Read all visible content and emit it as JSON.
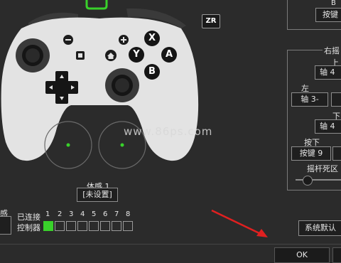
{
  "controller": {
    "zr_label": "ZR",
    "face_buttons": {
      "x": "X",
      "y": "Y",
      "a": "A",
      "b": "B"
    },
    "minus": "−",
    "plus": "+"
  },
  "motion": {
    "title": "体感 1",
    "status": "[未设置]"
  },
  "left_panel": {
    "partial_label": "感"
  },
  "connected": {
    "label_line1": "已连接",
    "label_line2": "控制器",
    "slots": [
      "1",
      "2",
      "3",
      "4",
      "5",
      "6",
      "7",
      "8"
    ],
    "active_slot": 1
  },
  "right_panel": {
    "b_label": "B",
    "b_value": "按键",
    "right_stick_title": "右摇",
    "up_label": "上",
    "up_value": "轴 4",
    "left_label": "左",
    "left_value": "轴 3-",
    "down_label": "下",
    "down_value": "轴 4",
    "press_label": "按下",
    "press_value": "按键 9",
    "deadzone_label": "摇杆死区",
    "system_default": "系统默认"
  },
  "footer": {
    "ok": "OK"
  },
  "watermark": "www.86ps.com",
  "colors": {
    "background": "#2b2b2b",
    "controller_body": "#e3e3e3",
    "active_indicator": "#39d12b",
    "arrow": "#e02020"
  }
}
